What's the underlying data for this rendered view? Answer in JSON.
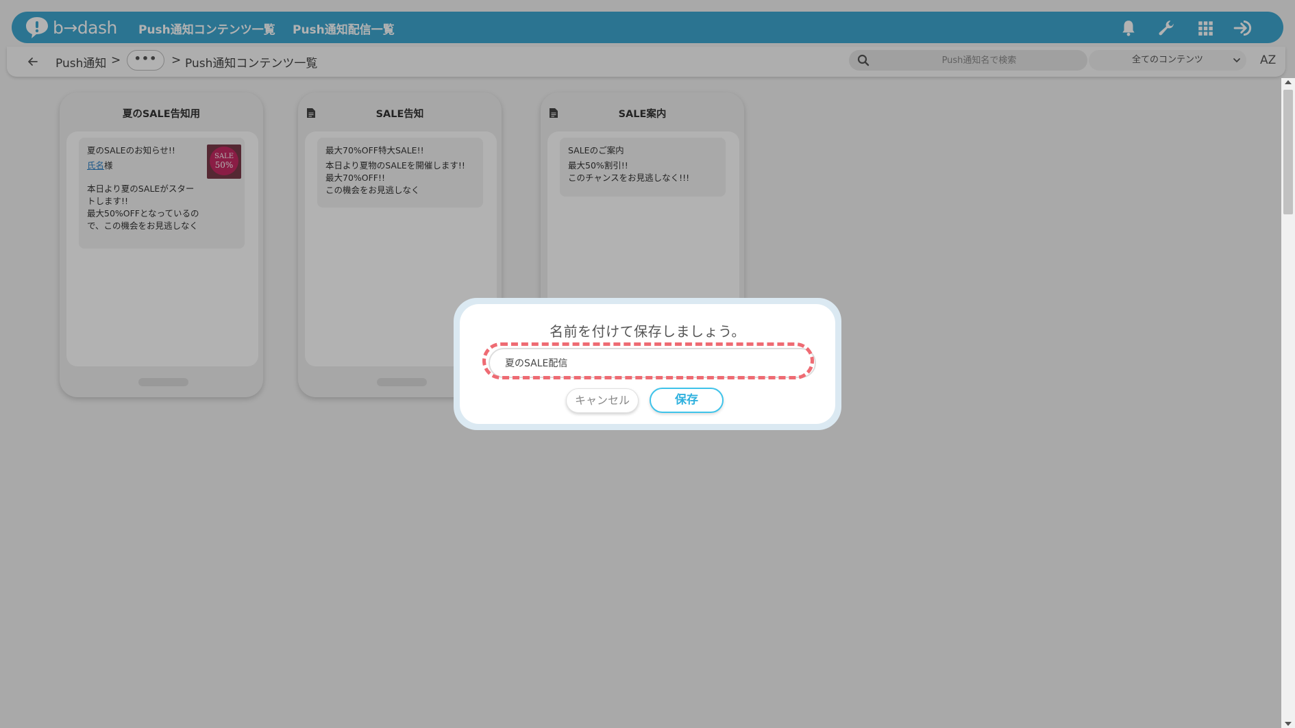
{
  "header": {
    "logo_text": "b→dash",
    "nav": [
      "Push通知コンテンツ一覧",
      "Push通知配信一覧"
    ],
    "icons": [
      "bell-icon",
      "wrench-icon",
      "grid-icon",
      "logout-icon"
    ]
  },
  "breadcrumb": {
    "root": "Push通知",
    "sep1": ">",
    "more": "•••",
    "sep2": ">",
    "current": "Push通知コンテンツ一覧"
  },
  "search": {
    "placeholder": "Push通知名で検索"
  },
  "filter": {
    "selected": "全てのコンテンツ"
  },
  "sort": {
    "label": "AZ"
  },
  "cards": [
    {
      "title": "夏のSALE告知用",
      "notif_title": "夏のSALEのお知らせ!!",
      "link_text": "氏名",
      "after_link": "様",
      "body": "本日より夏のSALEがスタートします!!\n最大50%OFFとなっているので、この機会をお見逃しなく",
      "thumb_text_1": "SALE",
      "thumb_text_2": "50%"
    },
    {
      "title": "SALE告知",
      "notif_title": "最大70%OFF特大SALE!!",
      "body": "本日より夏物のSALEを開催します!!\n最大70%OFF!!\nこの機会をお見逃しなく"
    },
    {
      "title": "SALE案内",
      "notif_title": "SALEのご案内",
      "body": "最大50%割引!!\nこのチャンスをお見逃しなく!!!"
    }
  ],
  "dialog": {
    "title": "名前を付けて保存しましょう。",
    "input_value": "夏のSALE配信",
    "cancel_label": "キャンセル",
    "save_label": "保存"
  },
  "colors": {
    "brand": "#3ea6d0",
    "highlight": "#ee6b73",
    "save_accent": "#3ec3ea"
  }
}
